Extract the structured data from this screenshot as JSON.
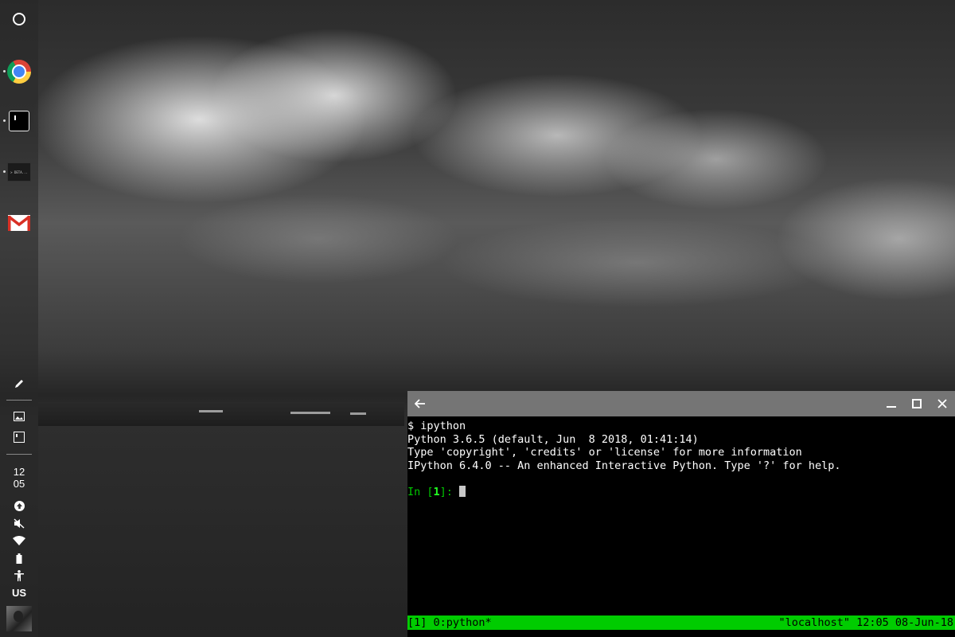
{
  "shelf": {
    "launcher_icon": "launcher-circle-icon",
    "apps": [
      {
        "name": "Chrome",
        "icon": "chrome-icon",
        "running": true
      },
      {
        "name": "Terminal",
        "icon": "terminal-icon",
        "running": true
      },
      {
        "name": "Terminal thumbnail",
        "icon": "window-thumbnail-icon",
        "running": true,
        "thumb_text": "> DETA..."
      },
      {
        "name": "Gmail",
        "icon": "gmail-icon",
        "running": false
      }
    ],
    "tray": {
      "stylus_icon": "pen-icon",
      "screenshot_icon": "image-icon",
      "window_icon": "window-icon",
      "clock_hour": "12",
      "clock_minute": "05",
      "status_icons": [
        "upload-icon",
        "mute-icon",
        "wifi-icon",
        "battery-icon",
        "accessibility-icon"
      ],
      "ime_label": "US",
      "avatar_icon": "user-avatar"
    }
  },
  "terminal": {
    "titlebar_color": "#757575",
    "back_icon": "back-arrow-icon",
    "minimize_icon": "minimize-icon",
    "maximize_icon": "maximize-icon",
    "close_icon": "close-icon",
    "lines": [
      "$ ipython",
      "Python 3.6.5 (default, Jun  8 2018, 01:41:14)",
      "Type 'copyright', 'credits' or 'license' for more information",
      "IPython 6.4.0 -- An enhanced Interactive Python. Type '?' for help."
    ],
    "prompt": {
      "prefix": "In [",
      "number": "1",
      "suffix": "]: "
    },
    "status": {
      "left": "[1] 0:python*",
      "right": "\"localhost\" 12:05 08-Jun-18",
      "color": "#00cc00"
    }
  }
}
